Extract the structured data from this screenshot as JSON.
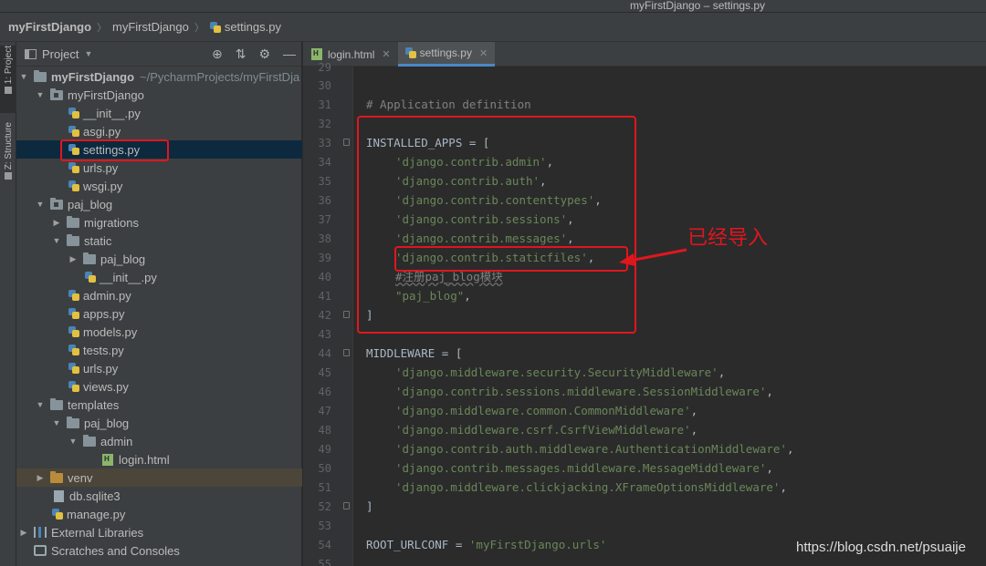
{
  "window": {
    "title": "myFirstDjango – settings.py"
  },
  "breadcrumbs": [
    "myFirstDjango",
    "myFirstDjango",
    "settings.py"
  ],
  "toolstrip": {
    "project_tab": "1: Project",
    "structure_tab": "Z: Structure"
  },
  "project_panel": {
    "title": "Project",
    "tree": [
      {
        "label": "myFirstDjango",
        "path": "~/PycharmProjects/myFirstDja"
      },
      {
        "label": "myFirstDjango"
      },
      {
        "label": "__init__.py"
      },
      {
        "label": "asgi.py"
      },
      {
        "label": "settings.py"
      },
      {
        "label": "urls.py"
      },
      {
        "label": "wsgi.py"
      },
      {
        "label": "paj_blog"
      },
      {
        "label": "migrations"
      },
      {
        "label": "static"
      },
      {
        "label": "paj_blog"
      },
      {
        "label": "__init__.py"
      },
      {
        "label": "admin.py"
      },
      {
        "label": "apps.py"
      },
      {
        "label": "models.py"
      },
      {
        "label": "tests.py"
      },
      {
        "label": "urls.py"
      },
      {
        "label": "views.py"
      },
      {
        "label": "templates"
      },
      {
        "label": "paj_blog"
      },
      {
        "label": "admin"
      },
      {
        "label": "login.html"
      },
      {
        "label": "venv"
      },
      {
        "label": "db.sqlite3"
      },
      {
        "label": "manage.py"
      },
      {
        "label": "External Libraries"
      },
      {
        "label": "Scratches and Consoles"
      }
    ]
  },
  "tabs": [
    {
      "label": "login.html",
      "active": false
    },
    {
      "label": "settings.py",
      "active": true
    }
  ],
  "editor": {
    "line_numbers": [
      "29",
      "30",
      "31",
      "32",
      "33",
      "34",
      "35",
      "36",
      "37",
      "38",
      "39",
      "40",
      "41",
      "42",
      "43",
      "44",
      "45",
      "46",
      "47",
      "48",
      "49",
      "50",
      "51",
      "52",
      "53",
      "54",
      "55"
    ],
    "lines": {
      "l30": "# Application definition",
      "l32a": "INSTALLED_APPS = [",
      "l33": "'django.contrib.admin'",
      "l34": "'django.contrib.auth'",
      "l35": "'django.contrib.contenttypes'",
      "l36": "'django.contrib.sessions'",
      "l37": "'django.contrib.messages'",
      "l38": "'django.contrib.staticfiles'",
      "l39": "#注册paj_blog模块",
      "l40": "\"paj_blog\"",
      "l41": "]",
      "l43": "MIDDLEWARE = [",
      "l44": "'django.middleware.security.SecurityMiddleware'",
      "l45": "'django.contrib.sessions.middleware.SessionMiddleware'",
      "l46": "'django.middleware.common.CommonMiddleware'",
      "l47": "'django.middleware.csrf.CsrfViewMiddleware'",
      "l48": "'django.contrib.auth.middleware.AuthenticationMiddleware'",
      "l49": "'django.contrib.messages.middleware.MessageMiddleware'",
      "l50": "'django.middleware.clickjacking.XFrameOptionsMiddleware'",
      "l51": "]",
      "l53a": "ROOT_URLCONF = ",
      "l53b": "'myFirstDjango.urls'"
    }
  },
  "annotation": {
    "text": "已经导入"
  },
  "watermark": "https://blog.csdn.net/psuaije",
  "colors": {
    "highlight": "#e0161e",
    "selection": "#0d293e",
    "string": "#6a8759",
    "comment": "#808080"
  }
}
